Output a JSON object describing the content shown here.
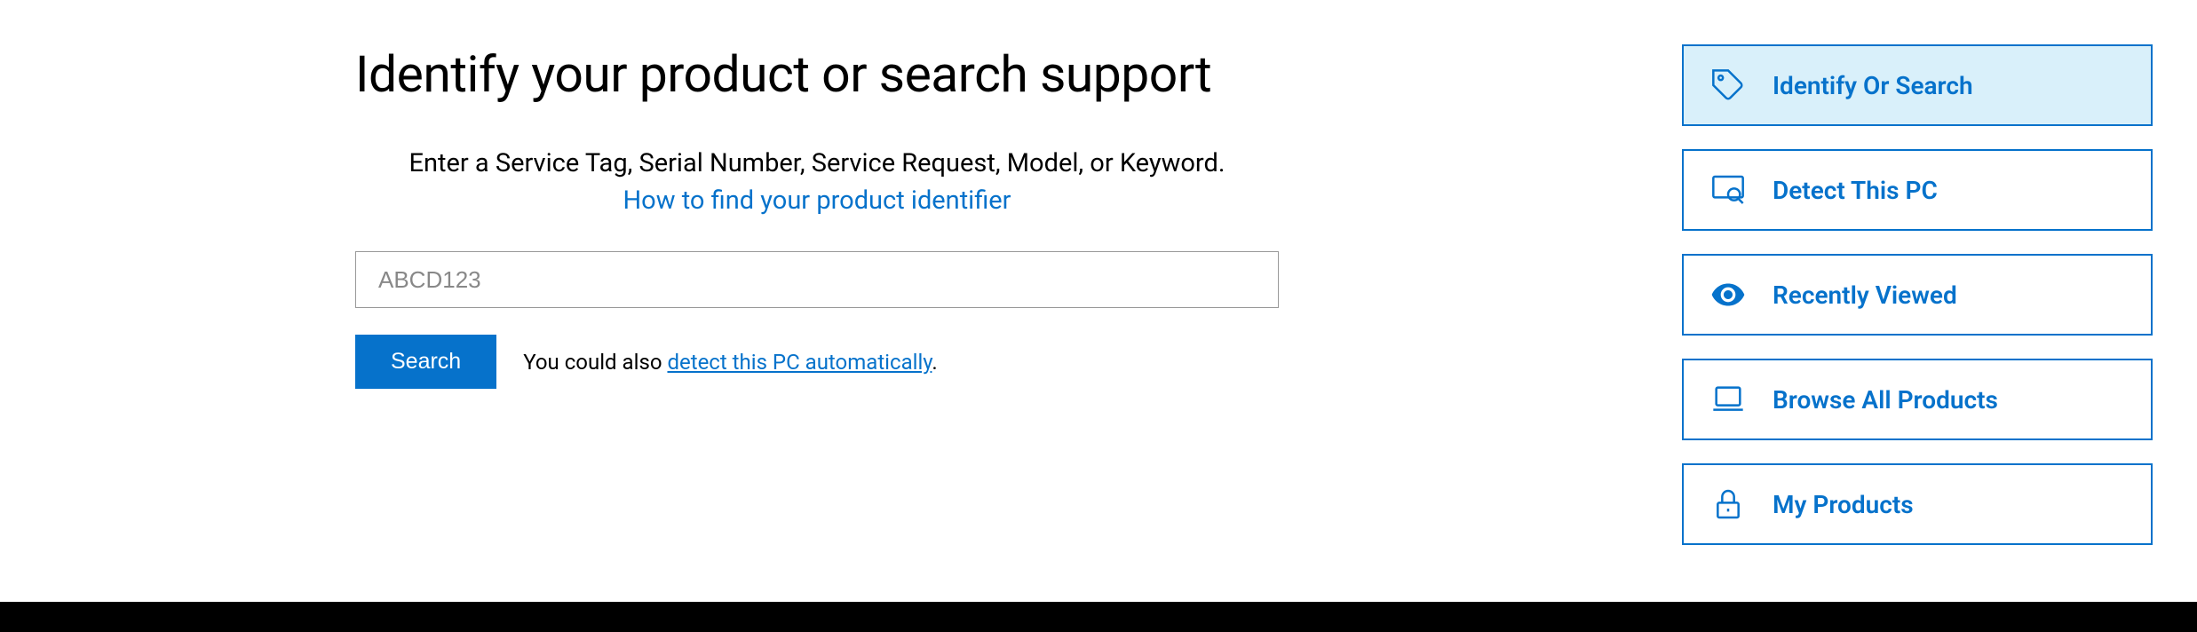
{
  "main": {
    "title": "Identify your product or search support",
    "instructions": "Enter a Service Tag, Serial Number, Service Request, Model, or Keyword.",
    "help_link": "How to find your product identifier",
    "search_placeholder": "ABCD123",
    "search_value": "",
    "search_button": "Search",
    "detect_prefix": "You could also ",
    "detect_link": "detect this PC automatically",
    "detect_suffix": "."
  },
  "sidebar": {
    "items": [
      {
        "label": "Identify Or Search",
        "active": true
      },
      {
        "label": "Detect This PC",
        "active": false
      },
      {
        "label": "Recently Viewed",
        "active": false
      },
      {
        "label": "Browse All Products",
        "active": false
      },
      {
        "label": "My Products",
        "active": false
      }
    ]
  }
}
